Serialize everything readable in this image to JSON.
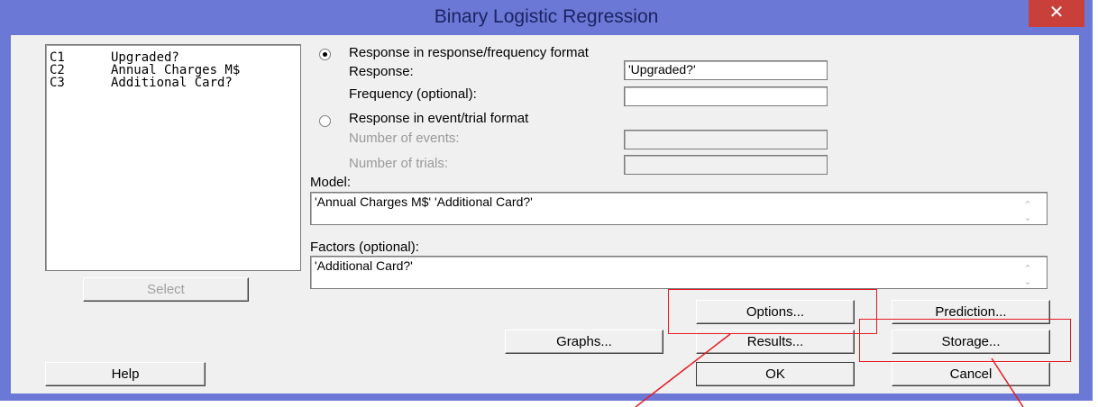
{
  "window": {
    "title": "Binary Logistic Regression",
    "close_glyph": "✕"
  },
  "variables": [
    {
      "col": "C1",
      "name": "Upgraded?"
    },
    {
      "col": "C2",
      "name": "Annual Charges M$"
    },
    {
      "col": "C3",
      "name": "Additional Card?"
    }
  ],
  "select_label": "Select",
  "response_freq": {
    "radio_label": "Response in response/frequency format",
    "selected": true,
    "response_label": "Response:",
    "response_value": "'Upgraded?'",
    "frequency_label": "Frequency (optional):",
    "frequency_value": ""
  },
  "response_event": {
    "radio_label": "Response in event/trial format",
    "selected": false,
    "events_label": "Number of events:",
    "trials_label": "Number of trials:"
  },
  "model": {
    "label": "Model:",
    "value": "'Annual Charges M$' 'Additional Card?'"
  },
  "factors": {
    "label": "Factors (optional):",
    "value": "'Additional Card?'"
  },
  "buttons": {
    "options": "Options...",
    "prediction": "Prediction...",
    "graphs": "Graphs...",
    "results": "Results...",
    "storage": "Storage...",
    "help": "Help",
    "ok": "OK",
    "cancel": "Cancel"
  },
  "colors": {
    "title_bar": "#6b78d6",
    "close_button": "#c9403a",
    "annotation": "#e51c23"
  }
}
